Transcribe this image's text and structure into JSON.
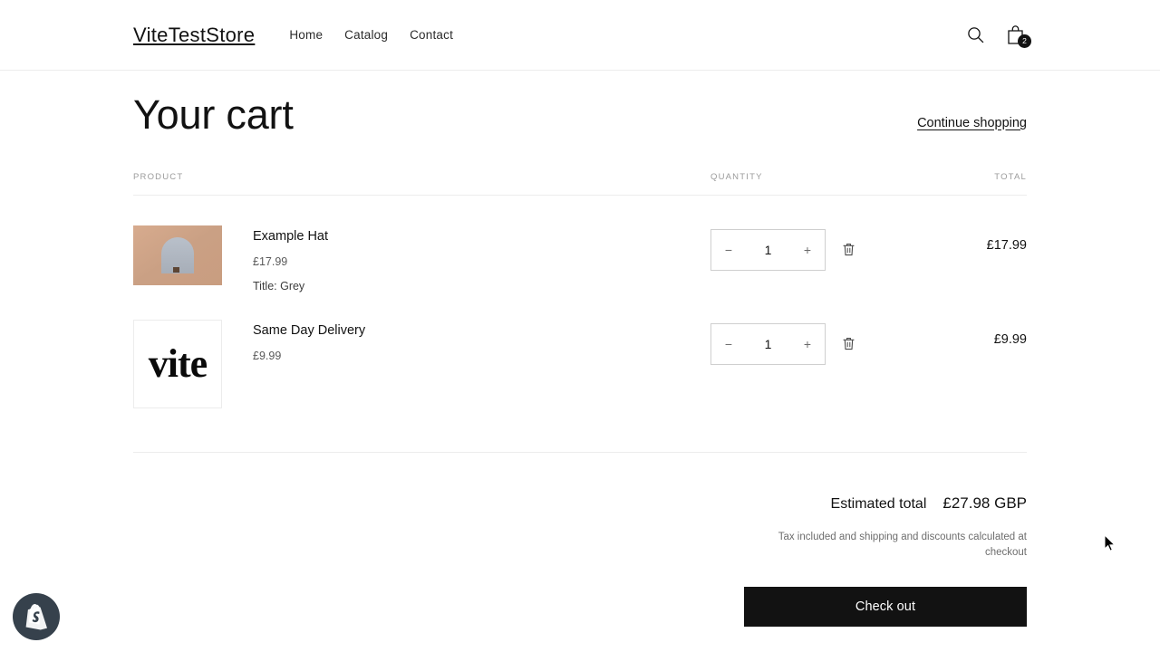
{
  "header": {
    "brand": "ViteTestStore",
    "nav": [
      {
        "label": "Home"
      },
      {
        "label": "Catalog"
      },
      {
        "label": "Contact"
      }
    ],
    "search_icon": "search-icon",
    "cart_icon": "shopping-bag-icon",
    "cart_count": "2"
  },
  "cart": {
    "title": "Your cart",
    "continue_shopping": "Continue shopping",
    "columns": {
      "product": "PRODUCT",
      "quantity": "QUANTITY",
      "total": "TOTAL"
    },
    "items": [
      {
        "title": "Example Hat",
        "price": "£17.99",
        "variant": "Title: Grey",
        "quantity": "1",
        "line_total": "£17.99",
        "decrease_label": "−",
        "increase_label": "+",
        "remove_icon": "trash-icon",
        "image_kind": "hat-photo"
      },
      {
        "title": "Same Day Delivery",
        "price": "£9.99",
        "variant": "",
        "quantity": "1",
        "line_total": "£9.99",
        "decrease_label": "−",
        "increase_label": "+",
        "remove_icon": "trash-icon",
        "image_kind": "vite-logo",
        "image_text": "vite"
      }
    ],
    "summary": {
      "estimated_total_label": "Estimated total",
      "estimated_total_value": "£27.98 GBP",
      "tax_note": "Tax included and shipping and discounts calculated at checkout",
      "checkout_label": "Check out"
    }
  },
  "shopify_badge": {
    "icon": "shopify-logo-icon"
  },
  "colors": {
    "text": "#121212",
    "muted": "#6d6d6d",
    "rule": "#ececec",
    "button_bg": "#121212",
    "badge_bg": "#36414c"
  }
}
